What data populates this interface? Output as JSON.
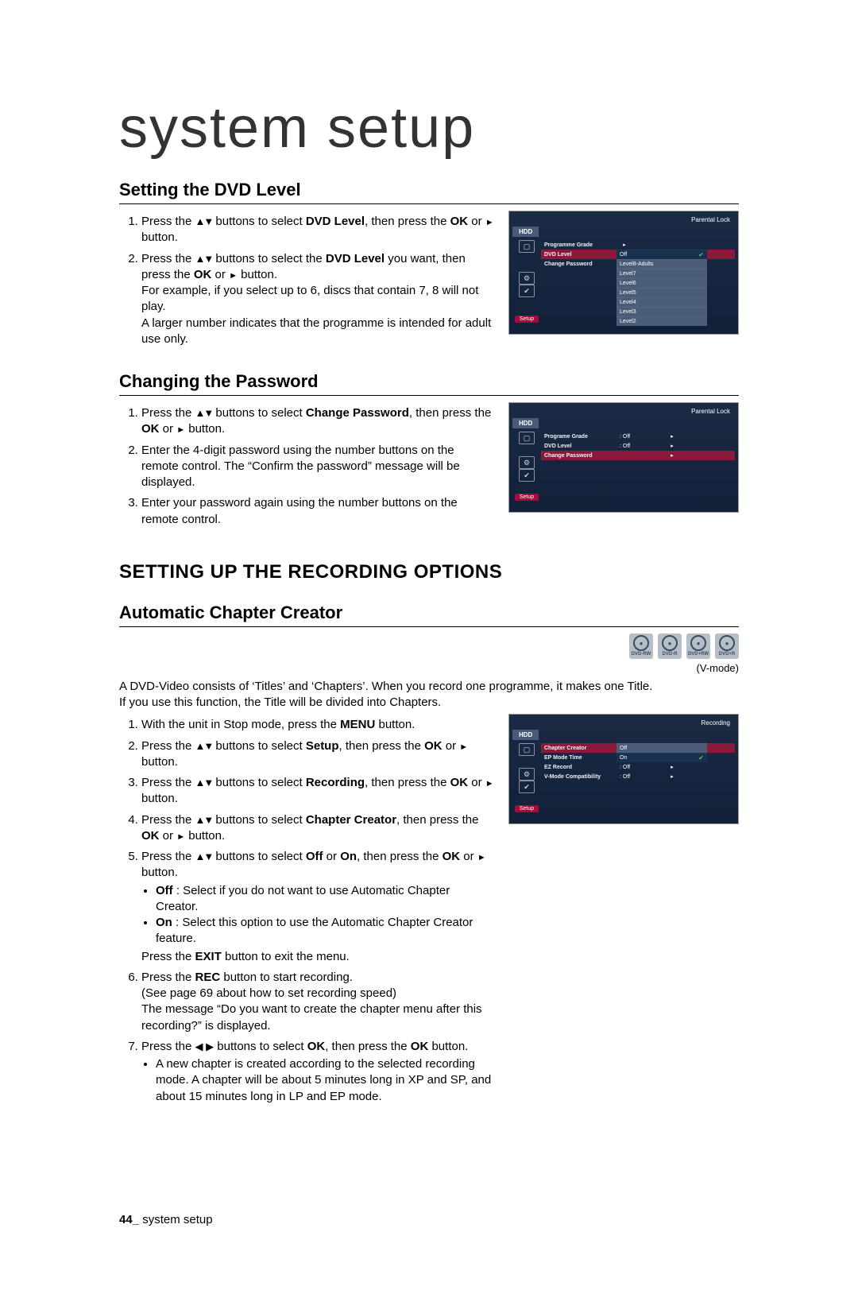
{
  "title": "system setup",
  "dvd_level": {
    "heading": "Setting the DVD Level",
    "li1a": "Press the ",
    "li1b": " buttons to select ",
    "li1_bold1": "DVD Level",
    "li1c": ", then press the ",
    "li1_bold2": "OK",
    "li1d": " or ",
    "li1e": " button.",
    "li2a": "Press the ",
    "li2b": " buttons to select the ",
    "li2_bold1": "DVD Level",
    "li2c": " you want, then press the ",
    "li2_bold2": "OK",
    "li2d": " or ",
    "li2e": " button.",
    "li2f": "For example, if you select up to 6, discs that contain 7, 8 will not play.",
    "li2g": "A larger number indicates that the programme is intended for adult use only."
  },
  "password": {
    "heading": "Changing the Password",
    "li1a": "Press the ",
    "li1b": " buttons to select ",
    "li1_bold1": "Change Password",
    "li1c": ", then press the ",
    "li1_bold2": "OK",
    "li1d": " or ",
    "li1e": " button.",
    "li2": "Enter the 4-digit password using the number buttons on the remote control. The “Confirm the password” message will be displayed.",
    "li3": "Enter your password again using the number buttons on the remote control."
  },
  "section2": "SETTING UP THE RECORDING OPTIONS",
  "chapter": {
    "heading": "Automatic Chapter Creator",
    "vmode": "(V-mode)",
    "intro1": "A DVD-Video consists of ‘Titles’ and ‘Chapters’. When you record one programme, it makes one Title.",
    "intro2": "If you use this function, the Title will be divided into Chapters.",
    "li1a": "With the unit in Stop mode, press the ",
    "li1_bold1": "MENU",
    "li1b": " button.",
    "li2a": "Press the ",
    "li2b": " buttons to select ",
    "li2_bold1": "Setup",
    "li2c": ", then press the ",
    "li2_bold2": "OK",
    "li2d": " or ",
    "li2e": " button.",
    "li3a": "Press the ",
    "li3b": " buttons to select ",
    "li3_bold1": "Recording",
    "li3c": ", then press the ",
    "li3_bold2": "OK",
    "li3d": " or ",
    "li3e": " button.",
    "li4a": "Press the ",
    "li4b": " buttons to select ",
    "li4_bold1": "Chapter Creator",
    "li4c": ", then press the ",
    "li4_bold2": "OK",
    "li4d": " or ",
    "li4e": " button.",
    "li5a": "Press the ",
    "li5b": " buttons to select ",
    "li5_bold1": "Off",
    "li5mid": " or ",
    "li5_bold2": "On",
    "li5c": ", then press the ",
    "li5_bold3": "OK",
    "li5d": " or ",
    "li5e": " button.",
    "li5_off": "Off",
    "li5_off_txt": " : Select if you do not want to use Automatic Chapter Creator.",
    "li5_on": "On",
    "li5_on_txt": " : Select this option to use the Automatic Chapter Creator feature.",
    "li5_exit1": "Press the ",
    "li5_exitB": "EXIT",
    "li5_exit2": " button to exit the menu.",
    "li6a": "Press the ",
    "li6_bold1": "REC",
    "li6b": " button to start recording.",
    "li6c": "(See page 69 about how to set recording speed)",
    "li6d": "The message “Do you want to create the chapter menu after this recording?” is displayed.",
    "li7a": "Press the ",
    "li7b": " buttons to select ",
    "li7_bold1": "OK",
    "li7c": ", then press the ",
    "li7_bold2": "OK",
    "li7d": " button.",
    "li7e": "A new chapter is created according to the selected recording mode. A chapter will be about 5 minutes long in XP and SP, and about 15 minutes long in LP and EP mode."
  },
  "shot1": {
    "title": "Parental Lock",
    "hdd": "HDD",
    "r1": "Programme Grade",
    "r2": "DVD Level",
    "r3": "Change Password",
    "opts": [
      "Off",
      "Level8-Adults",
      "Level7",
      "Level6",
      "Level5",
      "Level4",
      "Level3",
      "Level2"
    ],
    "setup": "Setup"
  },
  "shot2": {
    "title": "Parental Lock",
    "hdd": "HDD",
    "r1": "Programe Grade",
    "v1": ": Off",
    "r2": "DVD Level",
    "v2": ": Off",
    "r3": "Change Password",
    "setup": "Setup"
  },
  "shot3": {
    "title": "Recording",
    "hdd": "HDD",
    "r1": "Chapter Creator",
    "o1": "Off",
    "r2": "EP Mode Time",
    "o2": "On",
    "r3": "EZ Record",
    "v3": ": Off",
    "r4": "V-Mode Compatibility",
    "v4": ": Off",
    "setup": "Setup"
  },
  "discs": [
    "DVD-RW",
    "DVD-R",
    "DVD+RW",
    "DVD+R"
  ],
  "footer_page": "44_",
  "footer_text": " system setup"
}
